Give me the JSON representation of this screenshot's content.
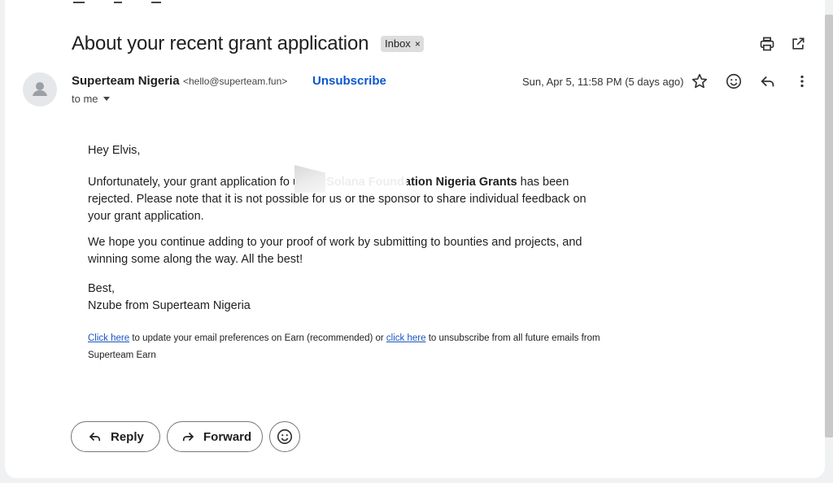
{
  "email": {
    "subject": "About your recent grant application",
    "label_chip": "Inbox",
    "label_remove": "×",
    "sender_name": "Superteam Nigeria",
    "sender_email": "<hello@superteam.fun>",
    "unsubscribe_label": "Unsubscribe",
    "recipient": "to me",
    "date": "Sun, Apr 5, 11:58 PM (5 days ago)"
  },
  "body": {
    "greeting": "Hey Elvis,",
    "p1_part1": "Unfortunately, your grant application fo",
    "p1_part2": " under ",
    "p1_bold": "Solana Foundation Nigeria Grants",
    "p1_part3": " has been rejected. Please note that it is not possible for us or the sponsor to share individual feedback on your grant application.",
    "p2": "We hope you continue adding to your proof of work by submitting to bounties and projects, and winning some along the way. All the best!",
    "signoff": "Best,",
    "signature": "Nzube from Superteam Nigeria"
  },
  "footer": {
    "link1": "Click here",
    "text1": " to update your email preferences on Earn (recommended) or ",
    "link2": "click here",
    "text2": " to unsubscribe from all future emails from Superteam Earn"
  },
  "actions": {
    "reply_label": "Reply",
    "forward_label": "Forward"
  },
  "icons": {
    "print": "print-icon",
    "popout": "open-in-new-window-icon",
    "star": "star-icon",
    "emoji": "add-reaction-icon",
    "reply": "reply-icon",
    "more": "more-vert-icon",
    "avatar": "default-avatar-icon"
  },
  "colors": {
    "link": "#1a55c0",
    "unsubscribe": "#0b57d0",
    "chip_bg": "#dddddd"
  }
}
